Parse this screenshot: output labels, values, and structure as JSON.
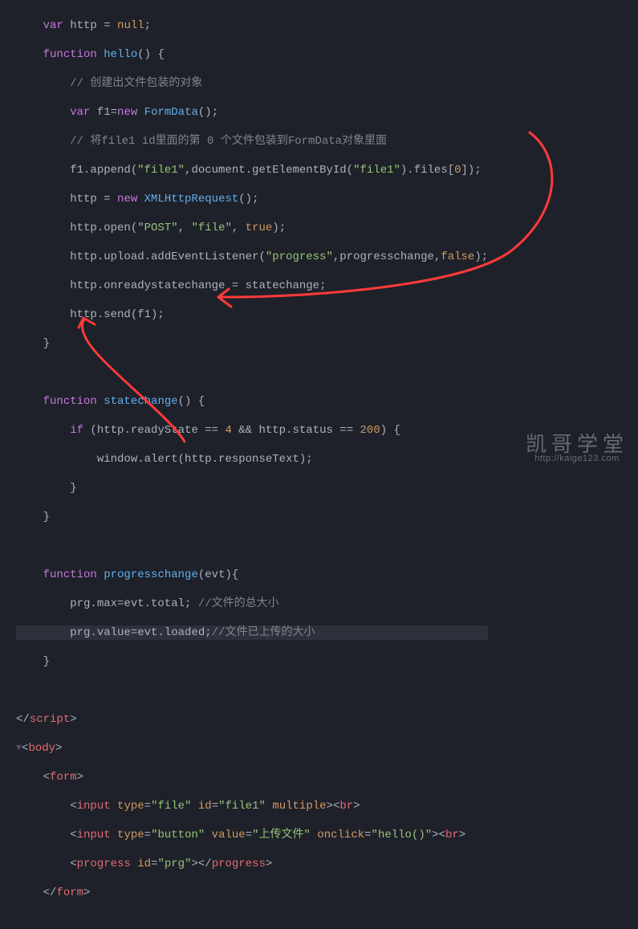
{
  "gutter": [
    "",
    "",
    "",
    "",
    "",
    "",
    "",
    "",
    "",
    "",
    "",
    "",
    "",
    "",
    "",
    "",
    "",
    "",
    "",
    "",
    "",
    "",
    "",
    "",
    "",
    "",
    "",
    "",
    "",
    "",
    "",
    ""
  ],
  "c": {
    "l0": {
      "a": "var",
      "b": " http = ",
      "c": "null",
      "d": ";"
    },
    "l1": {
      "a": "function",
      "b": " hello",
      "c": "() {"
    },
    "l2": {
      "a": "// 创建出文件包装的对象"
    },
    "l3": {
      "a": "var",
      "b": " f1=",
      "c": "new",
      "d": " FormData",
      "e": "();"
    },
    "l4": {
      "a": "// 将file1 id里面的第 0 个文件包装到FormData对象里面"
    },
    "l5": {
      "a": "f1.append(",
      "b": "\"file1\"",
      "c": ",document.getElementById(",
      "d": "\"file1\"",
      "e": ").files[",
      "f": "0",
      "g": "]);"
    },
    "l6": {
      "a": "http = ",
      "b": "new",
      "c": " XMLHttpRequest",
      "d": "();"
    },
    "l7": {
      "a": "http.open(",
      "b": "\"POST\"",
      "c": ", ",
      "d": "\"file\"",
      "e": ", ",
      "f": "true",
      "g": ");"
    },
    "l8": {
      "a": "http.upload.addEventListener(",
      "b": "\"progress\"",
      "c": ",progresschange,",
      "d": "false",
      "e": ");"
    },
    "l9": {
      "a": "http.onreadystatechange = statechange;"
    },
    "l10": {
      "a": "http.send(f1);"
    },
    "l11": {
      "a": "}"
    },
    "l12": {
      "a": ""
    },
    "l13": {
      "a": "function",
      "b": " statechange",
      "c": "() {"
    },
    "l14": {
      "a": "if",
      "b": " (http.readyState == ",
      "c": "4",
      "d": " && http.status == ",
      "e": "200",
      "f": ") {"
    },
    "l15": {
      "a": "window.alert(http.responseText);"
    },
    "l16": {
      "a": "}"
    },
    "l17": {
      "a": "}"
    },
    "l18": {
      "a": ""
    },
    "l19": {
      "a": "function",
      "b": " progresschange",
      "c": "(evt){"
    },
    "l20": {
      "a": "prg.max=evt.total; ",
      "b": "//文件的总大小"
    },
    "l21": {
      "a": "prg.value=evt.loaded;",
      "b": "//文件已上传的大小"
    },
    "l22": {
      "a": "}"
    },
    "l23": {
      "a": ""
    },
    "l24": {
      "a": "</",
      "b": "script",
      "c": ">"
    },
    "l25": {
      "a": "<",
      "b": "body",
      "c": ">"
    },
    "l26": {
      "a": "<",
      "b": "form",
      "c": ">"
    },
    "l27": {
      "a": "<",
      "b": "input",
      "c": " type",
      "d": "=",
      "e": "\"file\"",
      "f": " id",
      "g": "=",
      "h": "\"file1\"",
      "i": " multiple",
      "j": "><",
      "k": "br",
      "l": ">"
    },
    "l28": {
      "a": "<",
      "b": "input",
      "c": " type",
      "d": "=",
      "e": "\"button\"",
      "f": " value",
      "g": "=",
      "h": "\"上传文件\"",
      "i": " onclick",
      "j": "=",
      "k": "\"hello()\"",
      "l": "><",
      "m": "br",
      "n": ">"
    },
    "l29": {
      "a": "<",
      "b": "progress",
      "c": " id",
      "d": "=",
      "e": "\"prg\"",
      "f": "></",
      "g": "progress",
      "h": ">"
    },
    "l30": {
      "a": "</",
      "b": "form",
      "c": ">"
    }
  },
  "watermark": {
    "title": "凯哥学堂",
    "url": "http://kaige123.com"
  }
}
